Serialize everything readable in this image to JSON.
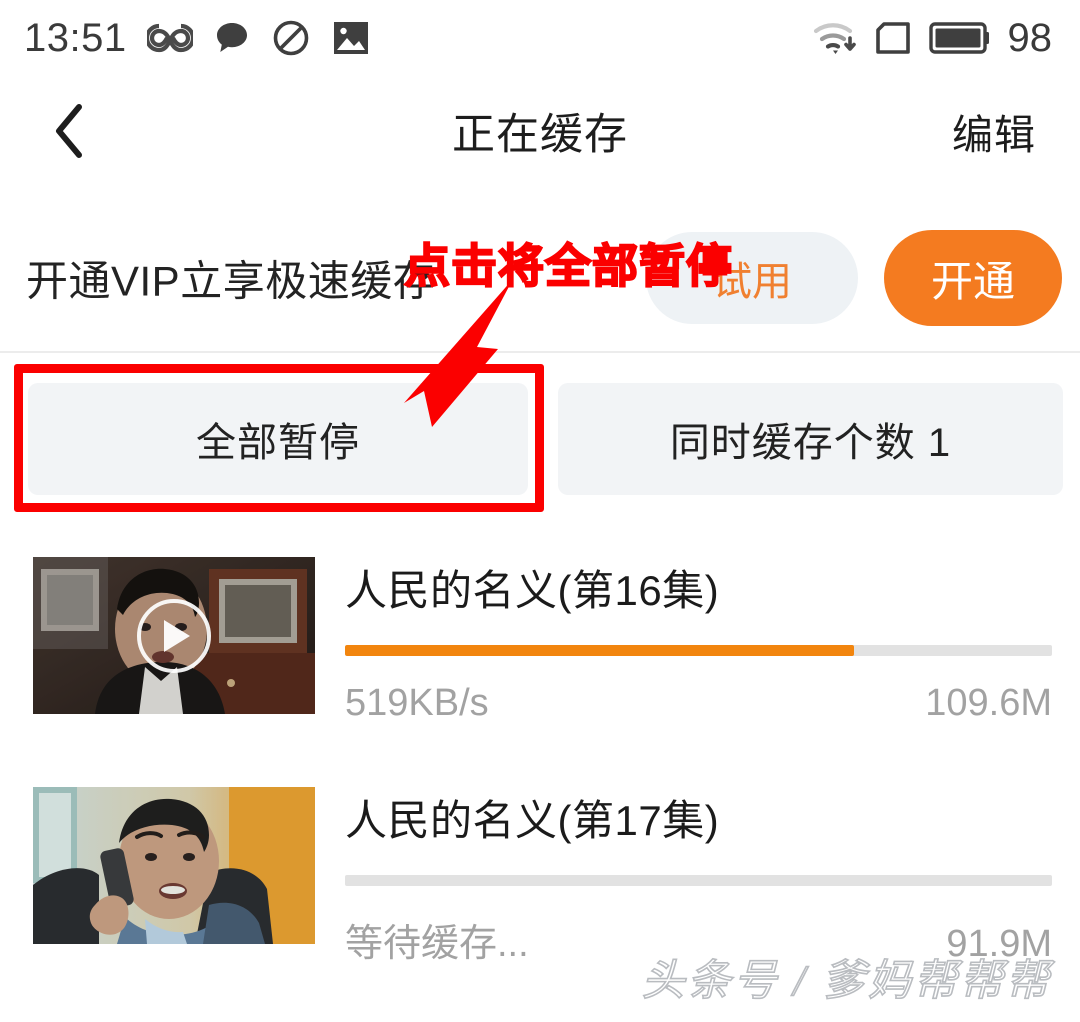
{
  "status_bar": {
    "time": "13:51",
    "battery_level": "98",
    "left_icons": [
      "infinity-icon",
      "chat-bubble-icon",
      "do-not-disturb-icon",
      "image-icon"
    ],
    "right_icons": [
      "wifi-download-icon",
      "sim-card-icon",
      "battery-icon"
    ]
  },
  "nav": {
    "back_icon": "chevron-left-icon",
    "title": "正在缓存",
    "edit_label": "编辑"
  },
  "vip_banner": {
    "promo_text": "开通VIP立享极速缓存",
    "trial_label": "试用",
    "open_label": "开通",
    "accent_color": "#f47b20",
    "trial_bg": "#eef2f5"
  },
  "controls": {
    "pause_all_label": "全部暂停",
    "concurrent_label": "同时缓存个数 1"
  },
  "annotation": {
    "text": "点击将全部暂停",
    "color": "#fb0000",
    "target": "全部暂停"
  },
  "downloads": [
    {
      "title": "人民的名义(第16集)",
      "speed": "519KB/s",
      "size": "109.6M",
      "progress_percent": 72,
      "progress_color": "#f2850e",
      "has_play_overlay": true,
      "thumbnail": "man-in-dark-suit-office"
    },
    {
      "title": "人民的名义(第17集)",
      "speed": "等待缓存...",
      "size": "91.9M",
      "progress_percent": 0,
      "progress_color": "#f2850e",
      "has_play_overlay": false,
      "thumbnail": "man-on-phone-blue-orange"
    }
  ],
  "watermark": {
    "text": "头条号 / 爹妈帮帮帮"
  }
}
